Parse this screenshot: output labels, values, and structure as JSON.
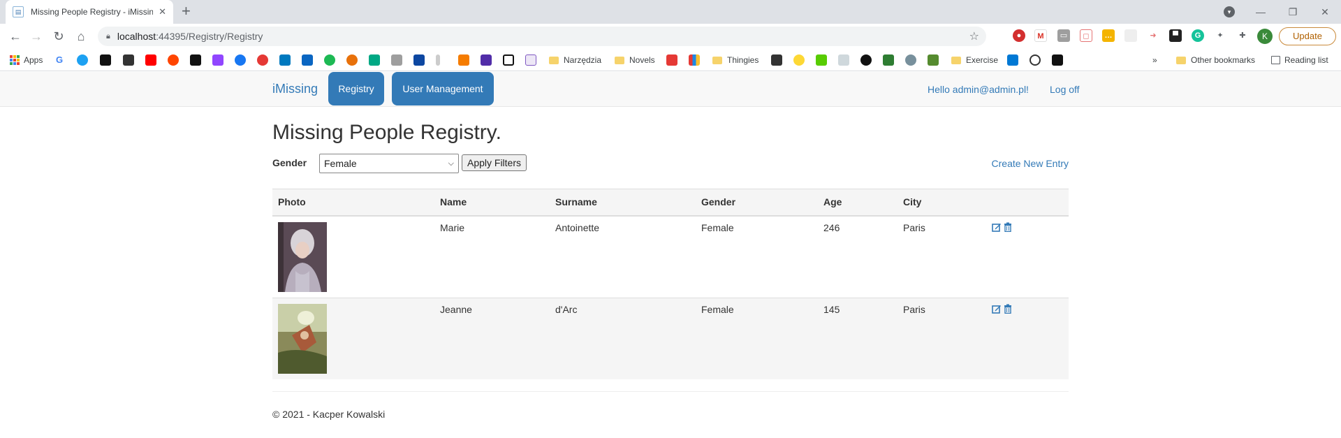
{
  "browser": {
    "tab_title": "Missing People Registry - iMissin",
    "url_host": "localhost",
    "url_path": ":44395/Registry/Registry",
    "update_label": "Update",
    "profile_initial": "K",
    "bookmarks": {
      "apps": "Apps",
      "narzedzia": "Narzędzia",
      "novels": "Novels",
      "thingies": "Thingies",
      "exercise": "Exercise",
      "overflow": "»",
      "other": "Other bookmarks",
      "reading_list": "Reading list"
    }
  },
  "nav": {
    "brand": "iMissing",
    "registry": "Registry",
    "user_management": "User Management",
    "greeting": "Hello admin@admin.pl!",
    "logoff": "Log off"
  },
  "page": {
    "title": "Missing People Registry.",
    "filter_label": "Gender",
    "gender_selected": "Female",
    "apply_label": "Apply Filters",
    "create_label": "Create New Entry"
  },
  "table": {
    "headers": [
      "Photo",
      "Name",
      "Surname",
      "Gender",
      "Age",
      "City"
    ],
    "rows": [
      {
        "name": "Marie",
        "surname": "Antoinette",
        "gender": "Female",
        "age": "246",
        "city": "Paris"
      },
      {
        "name": "Jeanne",
        "surname": "d'Arc",
        "gender": "Female",
        "age": "145",
        "city": "Paris"
      }
    ]
  },
  "footer": {
    "text": "© 2021 - Kacper Kowalski"
  },
  "colors": {
    "link": "#337ab7",
    "navbar_bg": "#f8f8f8",
    "stripe": "#f5f5f5"
  }
}
